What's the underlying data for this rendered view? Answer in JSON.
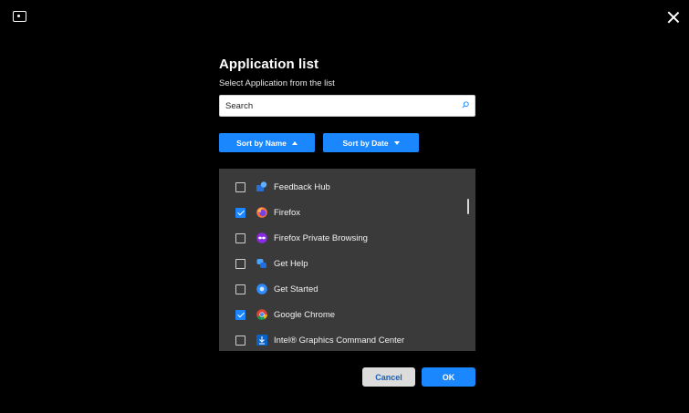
{
  "dialog": {
    "title": "Application list",
    "subtitle": "Select Application from the list"
  },
  "search": {
    "placeholder": "Search"
  },
  "sort": {
    "by_name_label": "Sort by Name",
    "by_date_label": "Sort by Date"
  },
  "apps": [
    {
      "label": "Feedback Hub",
      "checked": false,
      "icon": "feedback-hub-icon"
    },
    {
      "label": "Firefox",
      "checked": true,
      "icon": "firefox-icon"
    },
    {
      "label": "Firefox Private Browsing",
      "checked": false,
      "icon": "firefox-private-browsing-icon"
    },
    {
      "label": "Get Help",
      "checked": false,
      "icon": "get-help-icon"
    },
    {
      "label": "Get Started",
      "checked": false,
      "icon": "get-started-icon"
    },
    {
      "label": "Google Chrome",
      "checked": true,
      "icon": "google-chrome-icon"
    },
    {
      "label": "Intel® Graphics Command Center",
      "checked": false,
      "icon": "intel-graphics-icon"
    }
  ],
  "footer": {
    "cancel_label": "Cancel",
    "ok_label": "OK"
  },
  "colors": {
    "accent": "#1a87ff",
    "background": "#000000",
    "list_background": "#3a3a3a"
  }
}
